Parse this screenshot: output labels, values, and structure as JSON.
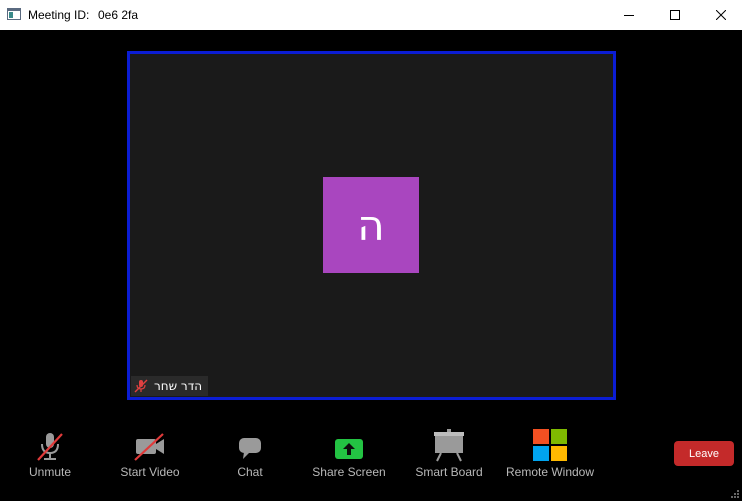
{
  "window": {
    "title_label": "Meeting ID:",
    "meeting_id": "0e6 2fa",
    "controls": {
      "minimize": "minimize-icon",
      "maximize": "maximize-icon",
      "close": "close-icon"
    }
  },
  "participant": {
    "initial": "ה",
    "name": "הדר שחר",
    "muted": true,
    "avatar_color": "#a946bf",
    "active_border_color": "#0b1dd4"
  },
  "toolbar": {
    "unmute": {
      "label": "Unmute",
      "icon": "microphone-muted-icon"
    },
    "start_video": {
      "label": "Start Video",
      "icon": "video-camera-off-icon"
    },
    "chat": {
      "label": "Chat",
      "icon": "chat-bubble-icon"
    },
    "share_screen": {
      "label": "Share Screen",
      "icon": "share-screen-icon",
      "color": "#23c343"
    },
    "smart_board": {
      "label": "Smart Board",
      "icon": "easel-board-icon"
    },
    "remote_window": {
      "label": "Remote Window",
      "icon": "windows-logo-icon"
    }
  },
  "leave": {
    "label": "Leave",
    "color": "#c42a2a"
  }
}
